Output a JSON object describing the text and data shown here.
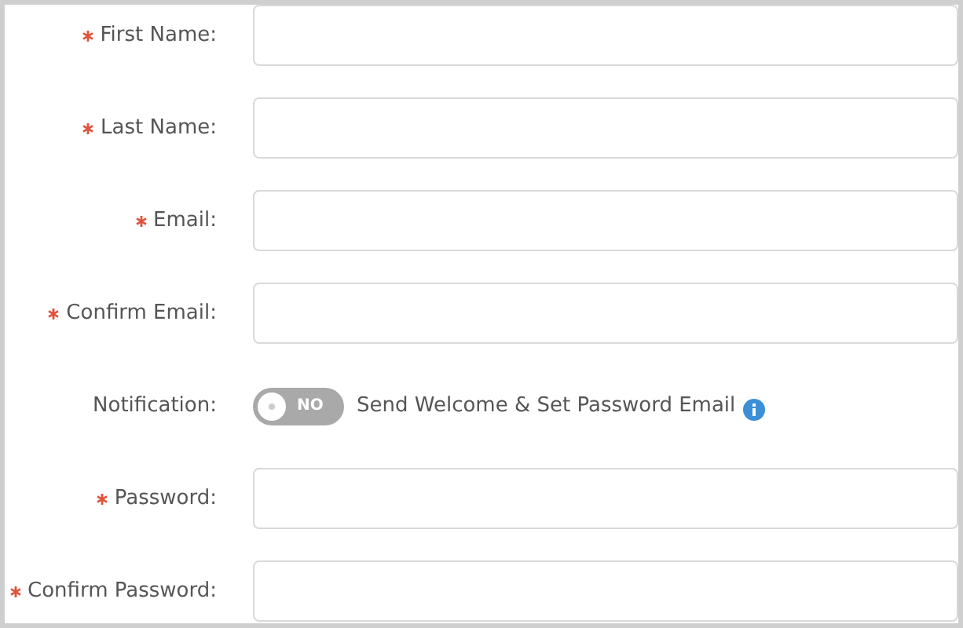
{
  "form": {
    "rows": [
      {
        "kind": "input",
        "label": "First Name:",
        "required": true
      },
      {
        "kind": "input",
        "label": "Last Name:",
        "required": true
      },
      {
        "kind": "input",
        "label": "Email:",
        "required": true
      },
      {
        "kind": "input",
        "label": "Confirm Email:",
        "required": true
      },
      {
        "kind": "toggle",
        "label": "Notification:",
        "required": false,
        "on": false,
        "toggle_text": "NO",
        "description": "Send Welcome & Set Password Email"
      },
      {
        "kind": "input",
        "label": "Password:",
        "required": true
      },
      {
        "kind": "input",
        "label": "Confirm Password:",
        "required": true
      }
    ]
  }
}
